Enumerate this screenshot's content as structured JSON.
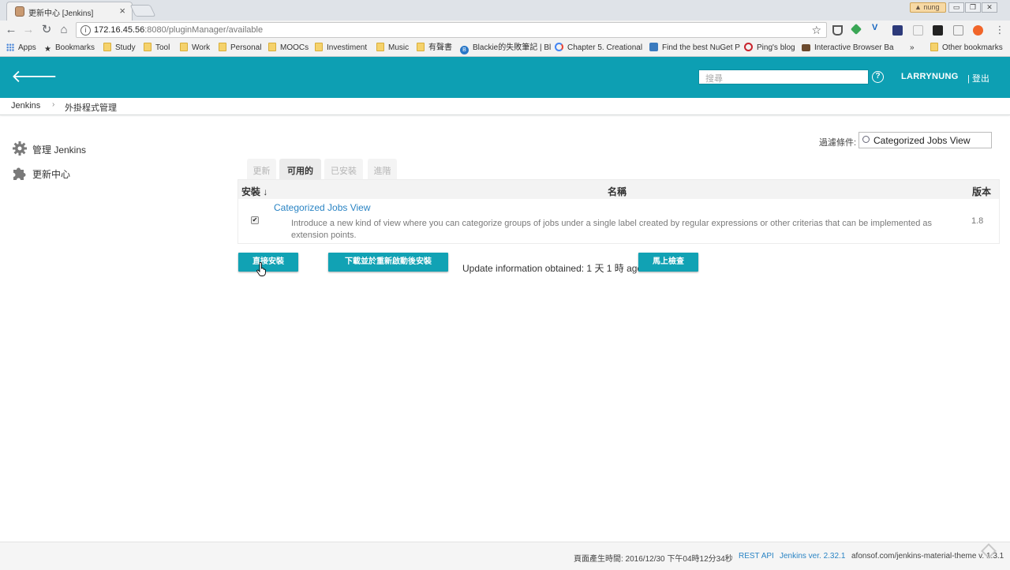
{
  "browser": {
    "tab_title": "更新中心 [Jenkins]",
    "tab_close": "×",
    "user_badge": "nung",
    "window_controls": {
      "minimize": "▭",
      "maximize": "❐",
      "close": "✕"
    },
    "url_host": "172.16.45.56",
    "url_rest": ":8080/pluginManager/available",
    "bookmarks": [
      {
        "label": "Apps",
        "icon": "apps-grid-icon"
      },
      {
        "label": "Bookmarks",
        "icon": "star-icon"
      },
      {
        "label": "Study",
        "icon": "folder-icon"
      },
      {
        "label": "Tool",
        "icon": "folder-icon"
      },
      {
        "label": "Work",
        "icon": "folder-icon"
      },
      {
        "label": "Personal",
        "icon": "folder-icon"
      },
      {
        "label": "MOOCs",
        "icon": "folder-icon"
      },
      {
        "label": "Investiment",
        "icon": "folder-icon"
      },
      {
        "label": "Music",
        "icon": "folder-icon"
      },
      {
        "label": "有聲書",
        "icon": "folder-icon"
      },
      {
        "label": "Blackie的失敗筆記 | Bl",
        "icon": "blog-icon"
      },
      {
        "label": "Chapter 5. Creational",
        "icon": "google-icon"
      },
      {
        "label": "Find the best NuGet P",
        "icon": "nuget-icon"
      },
      {
        "label": "Ping's blog",
        "icon": "pinterest-icon"
      },
      {
        "label": "Interactive Browser Ba",
        "icon": "fox-icon"
      },
      {
        "label": "»",
        "icon": ""
      },
      {
        "label": "Other bookmarks",
        "icon": "folder-icon"
      }
    ]
  },
  "header": {
    "search_placeholder": "搜尋",
    "help": "?",
    "user": "LARRYNUNG",
    "logout": "| 登出"
  },
  "breadcrumbs": [
    "Jenkins",
    "外掛程式管理"
  ],
  "breadcrumb_sep": "›",
  "sidebar": {
    "items": [
      {
        "label": "管理 Jenkins",
        "icon": "gear-icon"
      },
      {
        "label": "更新中心",
        "icon": "puzzle-icon"
      }
    ]
  },
  "filter": {
    "label": "過濾條件:",
    "value": "Categorized Jobs View"
  },
  "tabs": [
    "更新",
    "可用的",
    "已安裝",
    "進階"
  ],
  "active_tab": "可用的",
  "table": {
    "headers": {
      "install": "安裝 ↓",
      "name": "名稱",
      "version": "版本"
    },
    "rows": [
      {
        "checked": true,
        "name": "Categorized Jobs View",
        "description": "Introduce a new kind of view where you can categorize groups of jobs under a single label created by regular expressions or other criterias that can be implemented as extension points.",
        "version": "1.8"
      }
    ]
  },
  "actions": {
    "install_now": "直接安裝",
    "install_after_restart": "下載並於重新啟動後安裝",
    "update_info": "Update information obtained: 1 天 1 時 ago",
    "check_now": "馬上檢查"
  },
  "footer": {
    "generated": "頁面產生時間: 2016/12/30 下午04時12分34秒",
    "rest_api": "REST API",
    "jenkins_version": "Jenkins ver. 2.32.1",
    "theme": "afonsof.com/jenkins-material-theme v. 1.3.1"
  },
  "colors": {
    "header_bg": "#0d9fb3",
    "button_bg": "#11a2b4",
    "link": "#2a84c4"
  }
}
